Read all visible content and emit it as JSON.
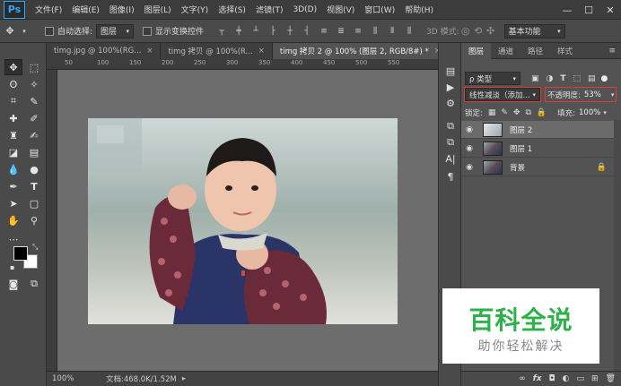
{
  "app": {
    "logo": "Ps"
  },
  "menubar": {
    "items": [
      "文件(F)",
      "编辑(E)",
      "图像(I)",
      "图层(L)",
      "文字(Y)",
      "选择(S)",
      "滤镜(T)",
      "3D(D)",
      "视图(V)",
      "窗口(W)",
      "帮助(H)"
    ],
    "window_controls": [
      "—",
      "☐",
      "✕"
    ]
  },
  "options": {
    "auto_select_label": "自动选择:",
    "auto_select_value": "图层",
    "show_transform_label": "显示变换控件",
    "mode_3d_label": "3D 模式:",
    "workspace": "基本功能"
  },
  "tabs": [
    {
      "label": "timg.jpg @ 100%(RG...",
      "active": false
    },
    {
      "label": "timg 拷贝 @ 100%(R...",
      "active": false
    },
    {
      "label": "timg 拷贝 2 @ 100% (图层 2, RGB/8#) *",
      "active": true
    }
  ],
  "ruler": {
    "top_labels": [
      "50",
      "100",
      "150",
      "200",
      "250",
      "300",
      "350",
      "400",
      "450",
      "500",
      "550"
    ]
  },
  "status": {
    "zoom": "100%",
    "doc": "文档:468.0K/1.52M"
  },
  "panel": {
    "tabs": [
      "图层",
      "通道",
      "路径",
      "样式"
    ],
    "filter_kind": "ρ 类型",
    "blend_mode": "线性减淡（添加...",
    "opacity_label": "不透明度:",
    "opacity_value": "53%",
    "lock_label": "锁定:",
    "fill_label": "填充:",
    "fill_value": "100%",
    "layers": [
      {
        "name": "图层 2",
        "selected": true,
        "locked": false
      },
      {
        "name": "图层 1",
        "selected": false,
        "locked": false
      },
      {
        "name": "背景",
        "selected": false,
        "locked": true
      }
    ],
    "bottom_icons": [
      "link-icon",
      "fx-icon",
      "mask-icon",
      "adjustment-icon",
      "group-icon",
      "new-layer-icon",
      "trash-icon"
    ]
  },
  "watermark": {
    "title": "百科全说",
    "subtitle": "助你轻松解决"
  }
}
